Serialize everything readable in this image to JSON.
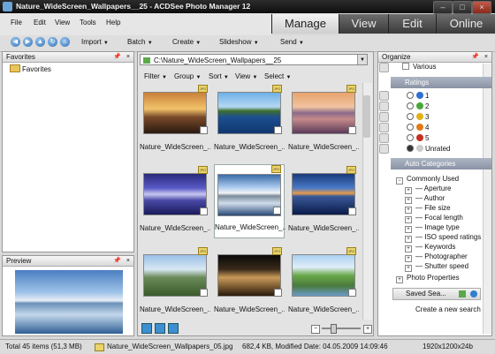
{
  "window": {
    "title": "Nature_WideScreen_Wallpapers__25 - ACDSee Photo Manager 12"
  },
  "mode_tabs": [
    "Manage",
    "View",
    "Edit",
    "Online"
  ],
  "menu": [
    "File",
    "Edit",
    "View",
    "Tools",
    "Help"
  ],
  "toolbar": {
    "items": [
      "Import",
      "Batch",
      "Create",
      "Slideshow",
      "Send"
    ]
  },
  "favorites": {
    "title": "Favorites",
    "root": "Favorites"
  },
  "preview": {
    "title": "Preview"
  },
  "browser": {
    "path": "C:\\Nature_WideScreen_Wallpapers__25",
    "filters": [
      "Filter",
      "Group",
      "Sort",
      "View",
      "Select"
    ],
    "thumbnails": [
      {
        "name": "Nature_WideScreen_..."
      },
      {
        "name": "Nature_WideScreen_..."
      },
      {
        "name": "Nature_WideScreen_..."
      },
      {
        "name": "Nature_WideScreen_..."
      },
      {
        "name": "Nature_WideScreen_..."
      },
      {
        "name": "Nature_WideScreen_..."
      },
      {
        "name": "Nature_WideScreen_..."
      },
      {
        "name": "Nature_WideScreen_..."
      },
      {
        "name": "Nature_WideScreen_..."
      }
    ],
    "jpg_badge": "JPG"
  },
  "organize": {
    "title": "Organize",
    "various": "Various",
    "ratings_title": "Ratings",
    "ratings": [
      "1",
      "2",
      "3",
      "4",
      "5",
      "Unrated"
    ],
    "auto_title": "Auto Categories",
    "commonly_used": "Commonly Used",
    "categories": [
      "Aperture",
      "Author",
      "File size",
      "Focal length",
      "Image type",
      "ISO speed ratings",
      "Keywords",
      "Photographer",
      "Shutter speed"
    ],
    "photo_properties": "Photo Properties",
    "saved_searches": "Saved Sea...",
    "create_search": "Create a new search"
  },
  "status": {
    "total": "Total 45 items  (51,3 MB)",
    "file": "Nature_WideScreen_Wallpapers_05.jpg",
    "info": "682,4 KB, Modified Date: 04.05.2009 14:09:46",
    "dims": "1920x1200x24b"
  },
  "colors": {
    "accent": "#3c6fb0",
    "titlebar": "#1a1a1a",
    "rating_colors": [
      "#2f6fd0",
      "#46a83a",
      "#e1b01c",
      "#e07a16",
      "#c4301f"
    ]
  }
}
